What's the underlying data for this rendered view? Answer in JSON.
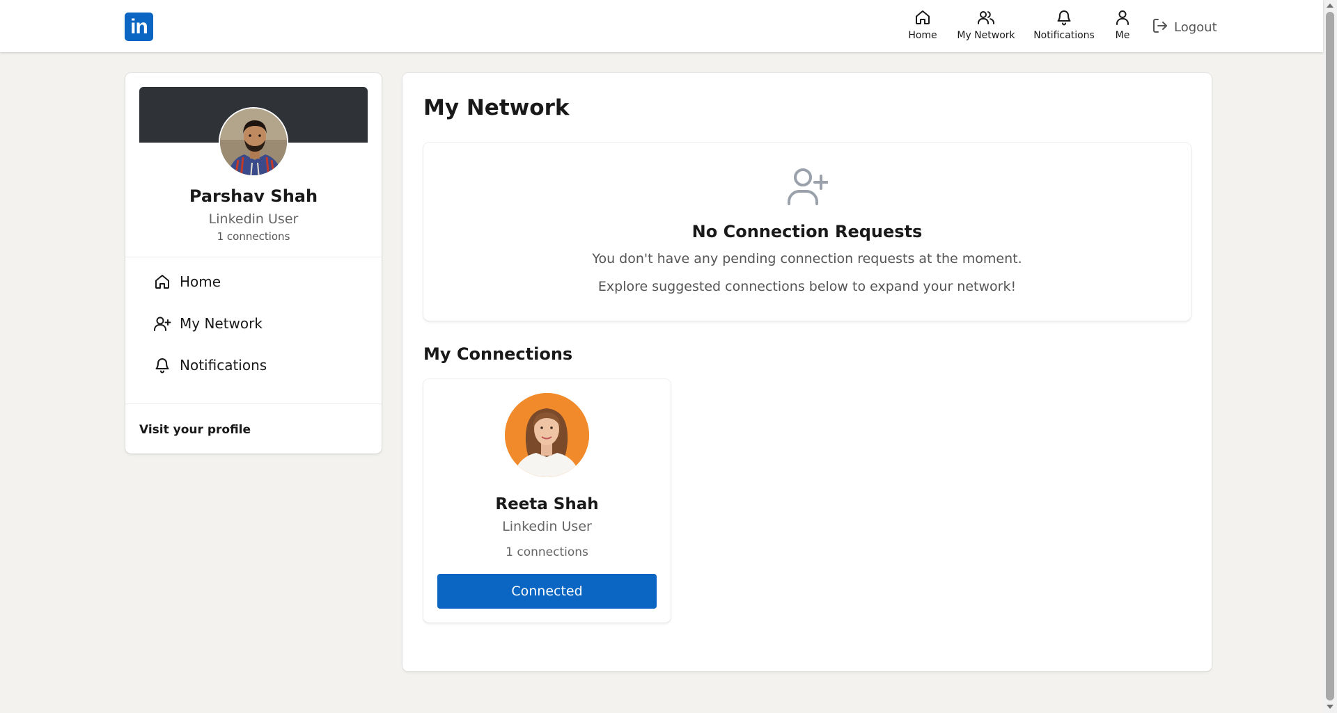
{
  "topnav": {
    "logo": "in",
    "items": [
      {
        "label": "Home",
        "icon": "home-icon"
      },
      {
        "label": "My Network",
        "icon": "people-icon"
      },
      {
        "label": "Notifications",
        "icon": "bell-icon"
      },
      {
        "label": "Me",
        "icon": "person-icon"
      }
    ],
    "logout_label": "Logout",
    "logout_icon": "logout-icon"
  },
  "profile": {
    "name": "Parshav Shah",
    "title": "Linkedin User",
    "connections": "1 connections",
    "banner_color": "#2f3236"
  },
  "sidebar": {
    "items": [
      {
        "label": "Home",
        "icon": "home-icon"
      },
      {
        "label": "My Network",
        "icon": "add-person-icon"
      },
      {
        "label": "Notifications",
        "icon": "bell-icon"
      }
    ],
    "visit_label": "Visit your profile"
  },
  "main": {
    "title": "My Network",
    "requests": {
      "icon": "add-person-icon",
      "title": "No Connection Requests",
      "line1": "You don't have any pending connection requests at the moment.",
      "line2": "Explore suggested connections below to expand your network!"
    },
    "connections_title": "My Connections",
    "connections": [
      {
        "name": "Reeta Shah",
        "title": "Linkedin User",
        "count": "1 connections",
        "button": "Connected"
      }
    ]
  },
  "colors": {
    "brand": "#0a66c2",
    "page_bg": "#f3f2ef",
    "card_bg": "#ffffff",
    "avatar_bg_orange": "#f08a2a"
  }
}
